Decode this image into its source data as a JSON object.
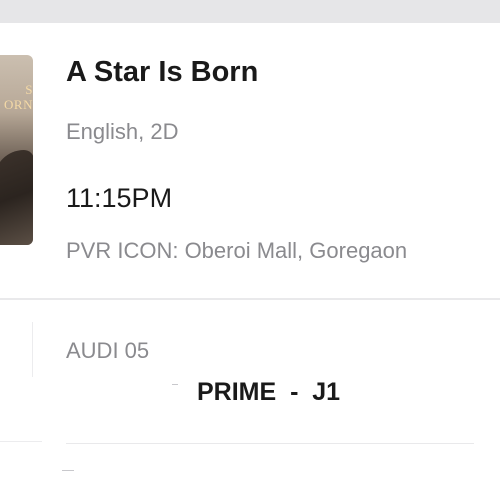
{
  "movie": {
    "title": "A Star Is Born",
    "format": "English, 2D",
    "poster_overlay_text": "S\nORN"
  },
  "showtime": {
    "time": "11:15PM",
    "venue": "PVR ICON: Oberoi Mall, Goregaon"
  },
  "seating": {
    "audi": "AUDI 05",
    "seat": "PRIME  -  J1"
  },
  "colors": {
    "background": "#ffffff",
    "top_band": "#e6e6e8",
    "primary_text": "#1a1a1a",
    "secondary_text": "#8a8a8e",
    "divider": "#e9e9eb"
  }
}
